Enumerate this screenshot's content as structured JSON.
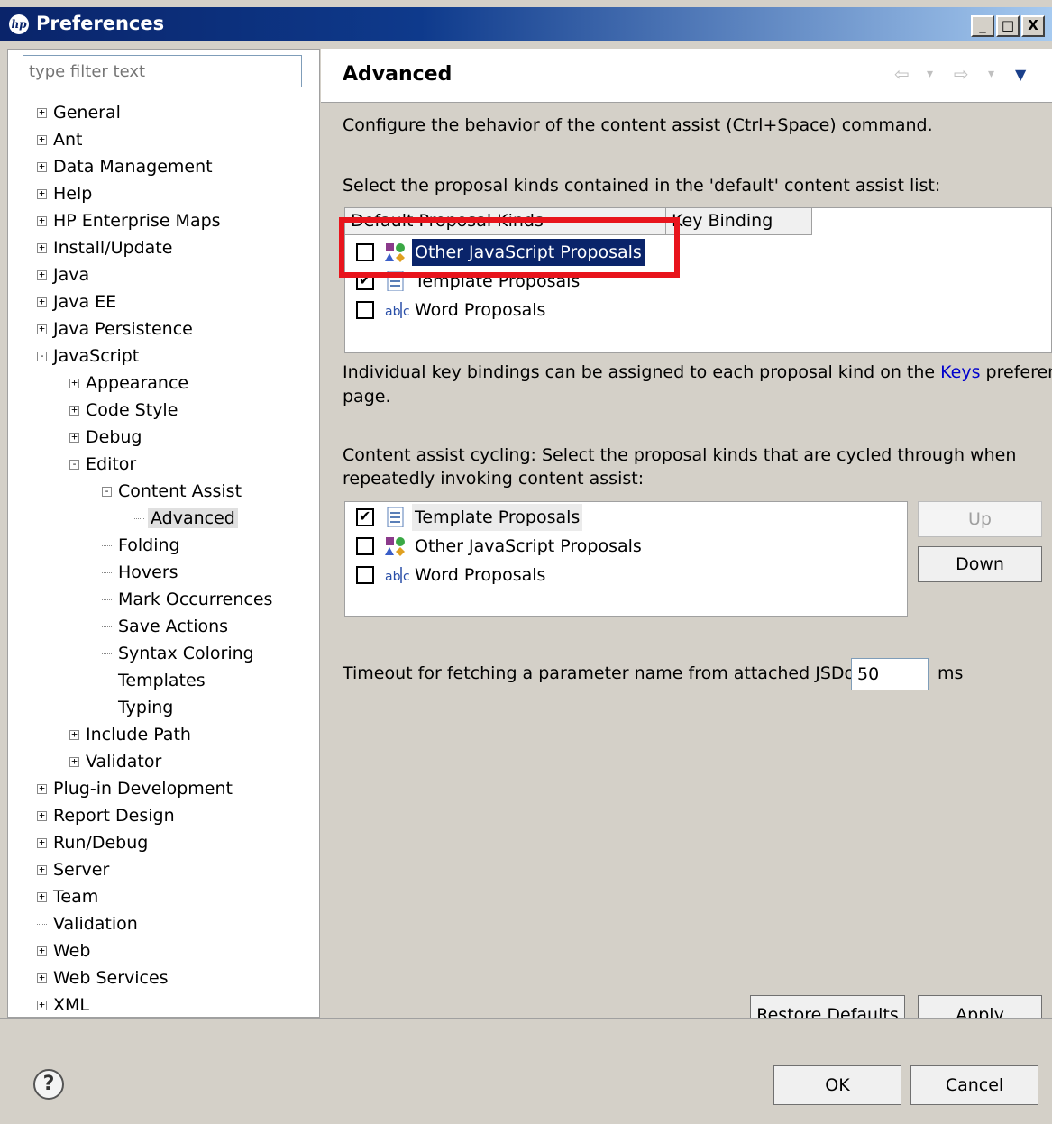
{
  "window": {
    "title": "Preferences",
    "minimize": "_",
    "maximize": "□",
    "close": "X",
    "logo": "hp"
  },
  "filter": {
    "placeholder": "type filter text"
  },
  "tree": [
    {
      "label": "General",
      "expander": "+"
    },
    {
      "label": "Ant",
      "expander": "+"
    },
    {
      "label": "Data Management",
      "expander": "+"
    },
    {
      "label": "Help",
      "expander": "+"
    },
    {
      "label": "HP Enterprise Maps",
      "expander": "+"
    },
    {
      "label": "Install/Update",
      "expander": "+"
    },
    {
      "label": "Java",
      "expander": "+"
    },
    {
      "label": "Java EE",
      "expander": "+"
    },
    {
      "label": "Java Persistence",
      "expander": "+"
    },
    {
      "label": "JavaScript",
      "expander": "-"
    },
    {
      "label": "Appearance",
      "expander": "+"
    },
    {
      "label": "Code Style",
      "expander": "+"
    },
    {
      "label": "Debug",
      "expander": "+"
    },
    {
      "label": "Editor",
      "expander": "-"
    },
    {
      "label": "Content Assist",
      "expander": "-"
    },
    {
      "label": "Advanced",
      "expander": ""
    },
    {
      "label": "Folding",
      "expander": ""
    },
    {
      "label": "Hovers",
      "expander": ""
    },
    {
      "label": "Mark Occurrences",
      "expander": ""
    },
    {
      "label": "Save Actions",
      "expander": ""
    },
    {
      "label": "Syntax Coloring",
      "expander": ""
    },
    {
      "label": "Templates",
      "expander": ""
    },
    {
      "label": "Typing",
      "expander": ""
    },
    {
      "label": "Include Path",
      "expander": "+"
    },
    {
      "label": "Validator",
      "expander": "+"
    },
    {
      "label": "Plug-in Development",
      "expander": "+"
    },
    {
      "label": "Report Design",
      "expander": "+"
    },
    {
      "label": "Run/Debug",
      "expander": "+"
    },
    {
      "label": "Server",
      "expander": "+"
    },
    {
      "label": "Team",
      "expander": "+"
    },
    {
      "label": "Validation",
      "expander": ""
    },
    {
      "label": "Web",
      "expander": "+"
    },
    {
      "label": "Web Services",
      "expander": "+"
    },
    {
      "label": "XML",
      "expander": "+"
    }
  ],
  "page": {
    "title": "Advanced",
    "nav": {
      "back": "⇦",
      "back_menu": "▾",
      "forward": "⇨",
      "forward_menu": "▾",
      "view_menu": "▼"
    },
    "description": "Configure the behavior of the content assist (Ctrl+Space) command.",
    "default_list_label": "Select the proposal kinds contained in the 'default' content assist list:",
    "default_table": {
      "columns": [
        "Default Proposal Kinds",
        "Key Binding"
      ],
      "rows": [
        {
          "label": "Other JavaScript Proposals",
          "checked": false,
          "icon": "javascript-proposals-icon"
        },
        {
          "label": "Template Proposals",
          "checked": true,
          "icon": "template-proposals-icon"
        },
        {
          "label": "Word Proposals",
          "checked": false,
          "icon": "word-proposals-icon"
        }
      ]
    },
    "keybind_text_before": "Individual key bindings can be assigned to each proposal kind on the ",
    "keybind_link": "Keys",
    "keybind_text_after": " preference",
    "keybind_text_line2": "page.",
    "cycling_label_line1": "Content assist cycling: Select the proposal kinds that are cycled through when",
    "cycling_label_line2": "repeatedly invoking content assist:",
    "cycling_list": [
      {
        "label": "Template Proposals",
        "checked": true,
        "icon": "template-proposals-icon"
      },
      {
        "label": "Other JavaScript Proposals",
        "checked": false,
        "icon": "javascript-proposals-icon"
      },
      {
        "label": "Word Proposals",
        "checked": false,
        "icon": "word-proposals-icon"
      }
    ],
    "up_button": "Up",
    "down_button": "Down",
    "timeout_label": "Timeout for fetching a parameter name from attached JSDoc:",
    "timeout_value": "50",
    "timeout_unit": "ms",
    "restore_defaults": "Restore Defaults",
    "apply": "Apply"
  },
  "footer": {
    "help": "?",
    "ok": "OK",
    "cancel": "Cancel"
  },
  "colors": {
    "titlebar": "#0a246a",
    "selection": "#0a246a",
    "annotation_box": "#e8141c"
  }
}
